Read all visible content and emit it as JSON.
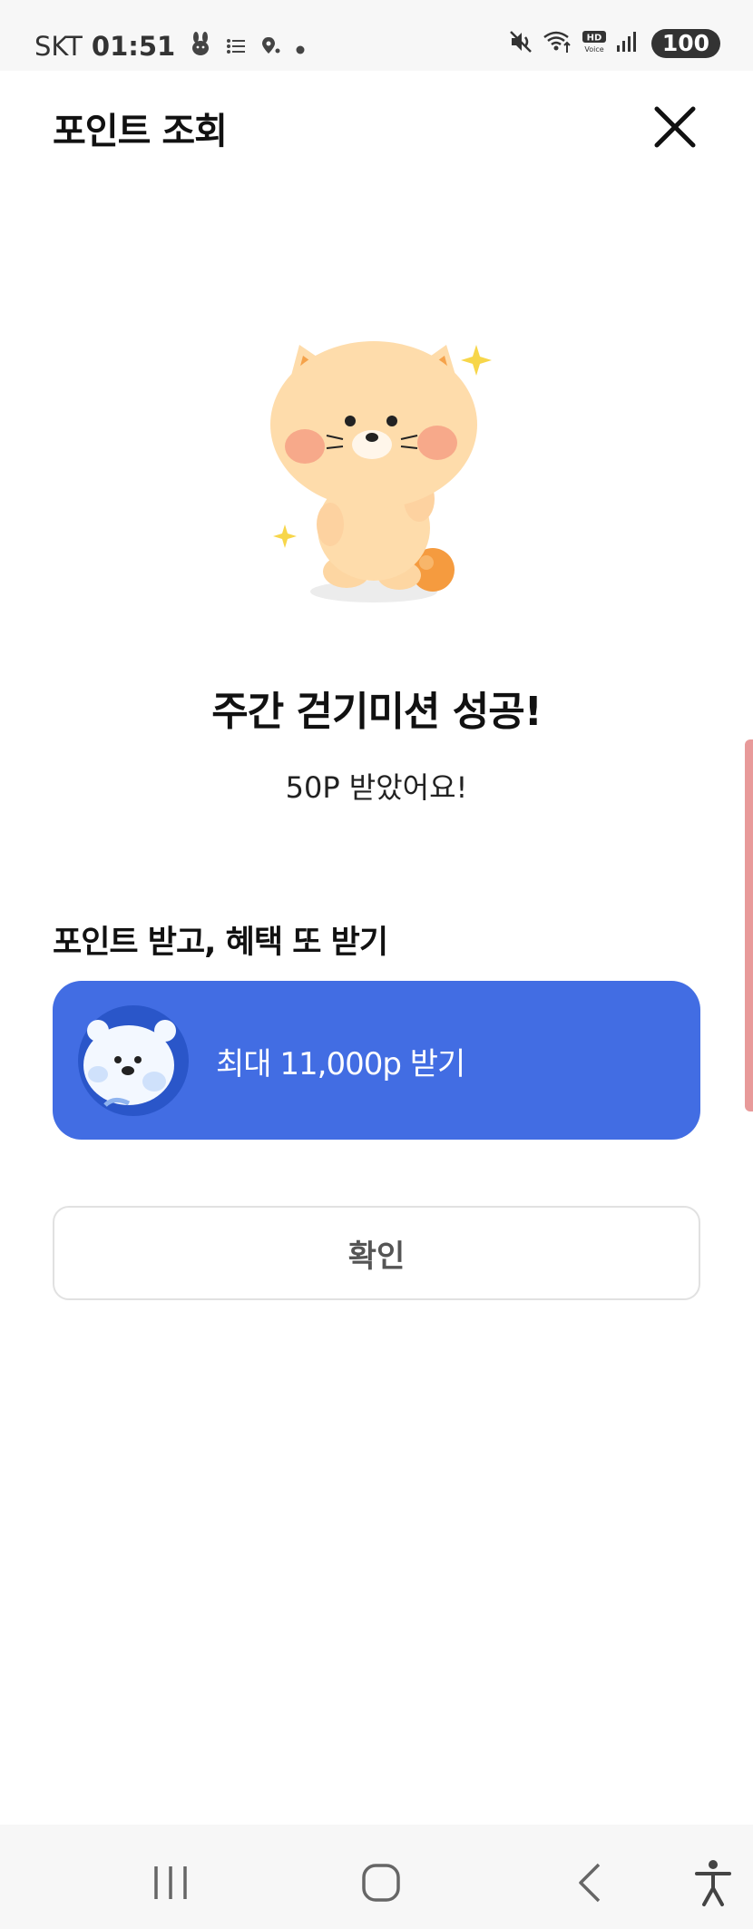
{
  "status_bar": {
    "carrier": "SKT",
    "time": "01:51",
    "battery": "100"
  },
  "header": {
    "title": "포인트 조회"
  },
  "success": {
    "title": "주간 걷기미션 성공!",
    "subtitle": "50P 받았어요!"
  },
  "benefit_section": {
    "title": "포인트 받고, 혜택 또 받기",
    "banner_label": "최대 11,000p 받기"
  },
  "confirm_button": {
    "label": "확인"
  },
  "colors": {
    "banner_bg": "#426de3",
    "status_bar_bg": "#f7f7f7",
    "confirm_text": "#555555"
  },
  "icons": {
    "close": "close-icon",
    "mute": "mute-icon",
    "wifi": "wifi-icon",
    "signal": "signal-icon",
    "nav_recents": "recents-icon",
    "nav_home": "home-icon",
    "nav_back": "back-icon",
    "nav_accessibility": "accessibility-icon"
  }
}
